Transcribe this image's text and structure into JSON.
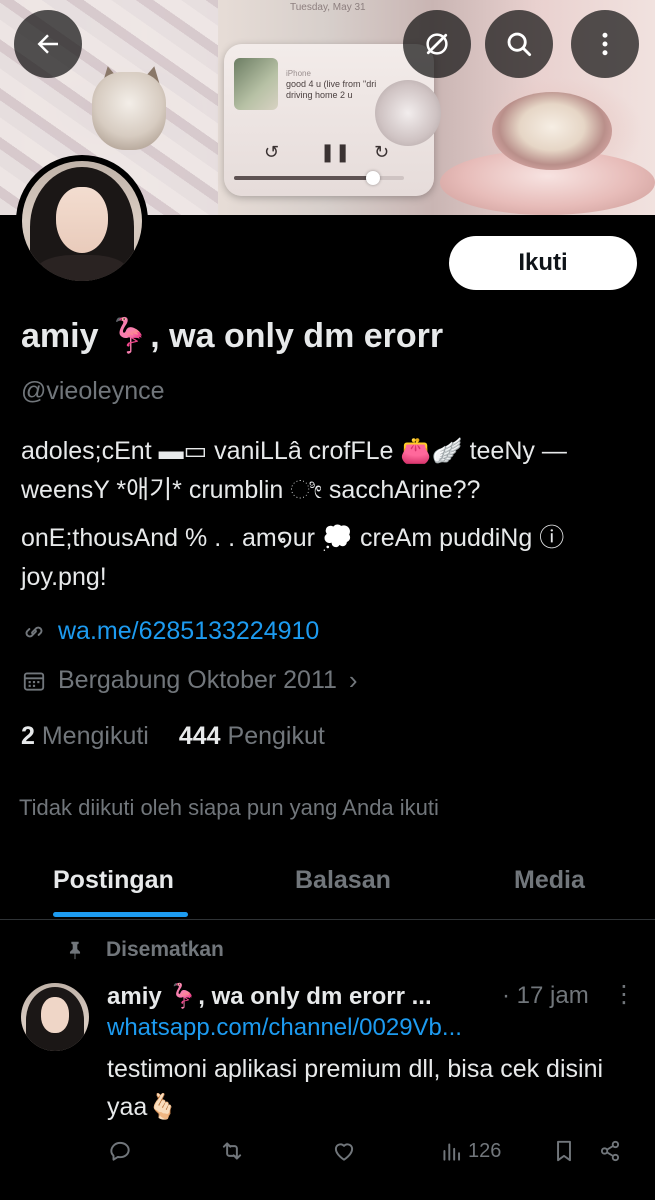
{
  "banner": {
    "date_text": "Tuesday, May 31",
    "song_title": "good 4 u (live from \"dri",
    "song_subtitle": "driving home 2 u",
    "device_label": "iPhone",
    "playback_progress": 0.82
  },
  "header": {
    "back_icon": "arrow-left-icon",
    "grok_icon": "slash-circle-icon",
    "search_icon": "search-icon",
    "more_icon": "more-vertical-icon"
  },
  "profile": {
    "follow_label": "Ikuti",
    "name": "amiy 🦩, wa only dm erorr",
    "handle": "@vieoleynce",
    "bio_line1": "adoles;cEnt ▬▭ vaniLLâ crofFLe 👛🪽 teeNy —weensY *애기* crumblin ೀ sacchArine??",
    "bio_line2": "onE;thousAnd % . . am໑ur 💭 creAm puddiNg ⓘ joy.png!",
    "link": "wa.me/6285133224910",
    "joined": "Bergabung Oktober 2011",
    "following_count": "2",
    "following_label": "Mengikuti",
    "followers_count": "444",
    "followers_label": "Pengikut",
    "not_followed_text": "Tidak diikuti oleh siapa pun yang Anda ikuti"
  },
  "tabs": [
    {
      "label": "Postingan",
      "active": true
    },
    {
      "label": "Balasan",
      "active": false
    },
    {
      "label": "Media",
      "active": false
    }
  ],
  "post": {
    "pinned_label": "Disematkan",
    "author": "amiy 🦩, wa only dm erorr ...",
    "time": "· 17 jam",
    "link": "whatsapp.com/channel/0029Vb...",
    "text": "testimoni aplikasi premium dll, bisa cek disini yaa🫰🏻",
    "views": "126"
  },
  "colors": {
    "background": "#000000",
    "accent": "#1d9bf0",
    "muted": "#71767b",
    "text": "#e7e9ea"
  }
}
